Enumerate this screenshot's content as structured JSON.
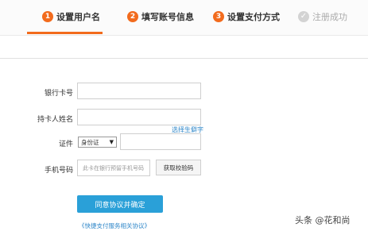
{
  "steps": [
    {
      "number": "1",
      "label": "设置用户名"
    },
    {
      "number": "2",
      "label": "填写账号信息"
    },
    {
      "number": "3",
      "label": "设置支付方式"
    },
    {
      "label": "注册成功"
    }
  ],
  "form": {
    "card_number_label": "银行卡号",
    "cardholder_label": "持卡人姓名",
    "rare_char_link": "选择生僻字",
    "id_label": "证件",
    "id_type_selected": "身份证",
    "phone_label": "手机号码",
    "phone_placeholder": "此卡在银行预留手机号码",
    "get_code_button": "获取校验码",
    "submit_button": "同意协议并确定",
    "agreement_link": "《快捷支付服务相关协议》"
  },
  "watermark": "头条 @花和尚",
  "colors": {
    "accent": "#f26b1d",
    "primary_button": "#2aa0d8",
    "link": "#2f87c9"
  }
}
